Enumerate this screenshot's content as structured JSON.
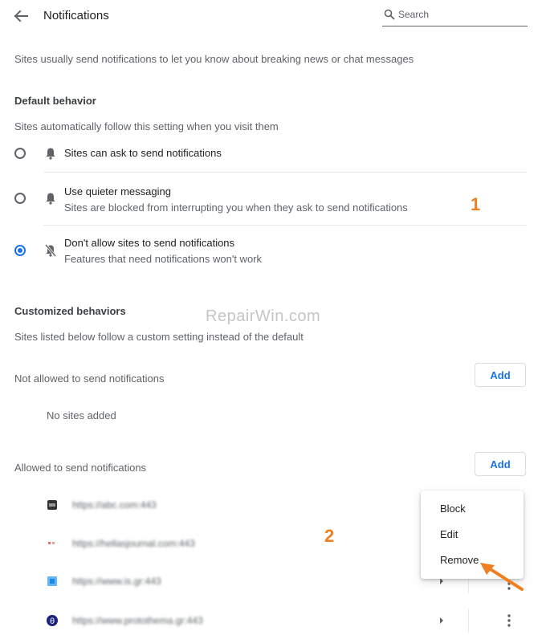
{
  "header": {
    "title": "Notifications",
    "search_placeholder": "Search"
  },
  "intro": "Sites usually send notifications to let you know about breaking news or chat messages",
  "default_behavior": {
    "heading": "Default behavior",
    "description": "Sites automatically follow this setting when you visit them",
    "options": [
      {
        "label": "Sites can ask to send notifications",
        "sublabel": "",
        "icon": "bell-icon",
        "selected": false
      },
      {
        "label": "Use quieter messaging",
        "sublabel": "Sites are blocked from interrupting you when they ask to send notifications",
        "icon": "bell-icon",
        "selected": false
      },
      {
        "label": "Don't allow sites to send notifications",
        "sublabel": "Features that need notifications won't work",
        "icon": "bell-off-icon",
        "selected": true
      }
    ]
  },
  "customized": {
    "heading": "Customized behaviors",
    "description": "Sites listed below follow a custom setting instead of the default",
    "not_allowed": {
      "label": "Not allowed to send notifications",
      "add_label": "Add",
      "empty_text": "No sites added"
    },
    "allowed": {
      "label": "Allowed to send notifications",
      "add_label": "Add",
      "sites": [
        {
          "url": "https://abc.com:443"
        },
        {
          "url": "https://hellasjournal.com:443"
        },
        {
          "url": "https://www.is.gr:443"
        },
        {
          "url": "https://www.protothema.gr:443"
        }
      ]
    }
  },
  "context_menu": {
    "items": [
      "Block",
      "Edit",
      "Remove"
    ]
  },
  "annotations": {
    "step1": "1",
    "step2": "2",
    "watermark": "RepairWin.com"
  },
  "colors": {
    "accent": "#1a73e8",
    "annotation": "#f07f20"
  }
}
